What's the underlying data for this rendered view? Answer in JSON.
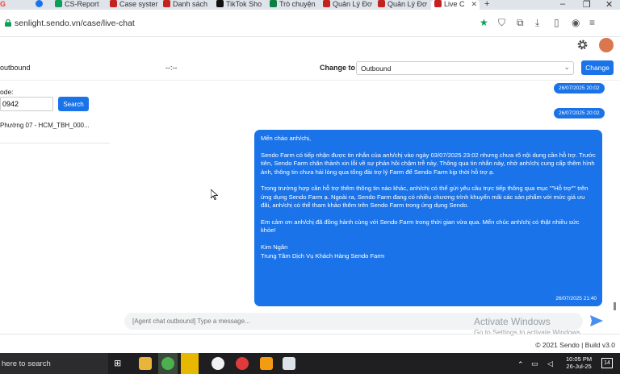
{
  "browser": {
    "tabs": [
      {
        "label": "G",
        "color": "#ea4335",
        "active": false
      },
      {
        "label": "",
        "color": "#1a73e8",
        "active": false
      },
      {
        "label": "CS-Report",
        "color": "#0f9d58",
        "active": false
      },
      {
        "label": "Case syster",
        "color": "#c5221f",
        "active": false
      },
      {
        "label": "Danh sách",
        "color": "#c5221f",
        "active": false
      },
      {
        "label": "TikTok Sho",
        "color": "#111111",
        "active": false
      },
      {
        "label": "Trò chuyện",
        "color": "#0b8043",
        "active": false
      },
      {
        "label": "Quản Lý Đơ",
        "color": "#c5221f",
        "active": false
      },
      {
        "label": "Quản Lý Đơ",
        "color": "#c5221f",
        "active": false
      },
      {
        "label": "Live C",
        "color": "#c5221f",
        "active": true
      }
    ],
    "new_tab": "+",
    "url": "senlight.sendo.vn/case/live-chat"
  },
  "control": {
    "channel_label": "outbound",
    "timer": "--:--",
    "change_to_label": "Change to",
    "change_to_value": "Outbound",
    "change_button": "Change"
  },
  "left": {
    "code_label": "ode:",
    "code_value": "0942",
    "search_button": "Search",
    "result_item": "Phường 07 - HCM_TBH_000..."
  },
  "chat": {
    "timestamps": [
      "26/07/2025 20:02",
      "26/07/2025 20:02"
    ],
    "message": {
      "paragraphs": [
        "Mến chào anh/chị,",
        "Sendo Farm có tiếp nhận được tin nhắn của anh/chị vào ngày  03/07/2025 23:02 nhưng chưa rõ nội dung cần hỗ trợ. Trước tiên, Sendo Farm chân thành xin lỗi về sự phản hồi chậm trễ này. Thông qua tin nhắn này, nhờ anh/chị cung cấp thêm hình ảnh, thông tin chưa hài lòng qua tổng đài trợ lý Farm để Sendo Farm kịp thời hỗ trợ ạ.",
        "Trong trường hợp cần hỗ trợ thêm thông tin nào khác, anh/chị có thể gửi yêu cầu trực tiếp thông qua mục \"\"Hỗ trợ\"\" trên ứng dụng Sendo Farm ạ. Ngoài ra, Sendo Farm đang có nhiều chương trình khuyến mãi các sản phẩm với mức giá ưu đãi, anh/chị có thể tham khảo thêm trên Sendo Farm trong ứng dụng Sendo.",
        "Em cảm ơn anh/chị đã đồng hành cùng với Sendo Farm trong thời gian vừa qua. Mến chúc anh/chị có thật nhiều sức khỏe!"
      ],
      "signature_name": "Kim Ngân",
      "signature_team": "Trung Tâm Dịch Vụ Khách Hàng Sendo Farm",
      "time": "26/07/2025 21:40"
    },
    "input_placeholder": "[Agent chat outbound] Type a message..."
  },
  "watermark": {
    "line1": "Activate Windows",
    "line2": "Go to Settings to activate Windows."
  },
  "footer": "© 2021 Sendo | Build v3.0",
  "taskbar": {
    "search_placeholder": "here to search",
    "time": "10:05 PM",
    "date": "26-Jul-25",
    "badge": "14"
  },
  "colors": {
    "accent": "#1a73e8",
    "taskbar": "#1f1f22"
  }
}
